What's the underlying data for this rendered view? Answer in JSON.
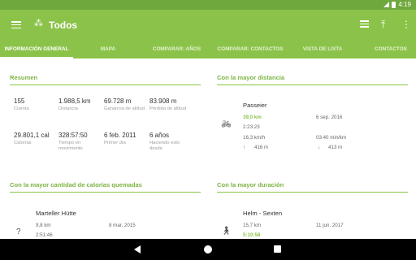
{
  "status": {
    "time": "4:19"
  },
  "appbar": {
    "title": "Todos",
    "logo_glyph": "⁂"
  },
  "tabs": [
    {
      "label": "INFORMACIÓN GENERAL"
    },
    {
      "label": "MAPA"
    },
    {
      "label": "COMPARAR: AÑOS"
    },
    {
      "label": "COMPARAR: CONTACTOS"
    },
    {
      "label": "VISTA DE LISTA"
    },
    {
      "label": "CONTACTOS"
    }
  ],
  "resumen": {
    "title": "Resumen",
    "stats": [
      {
        "value": "155",
        "label": "Cuenta"
      },
      {
        "value": "1.988,5 km",
        "label": "Distancia"
      },
      {
        "value": "69.728 m",
        "label": "Ganancia de altitud"
      },
      {
        "value": "83.908 m",
        "label": "Pérdida de altitud"
      },
      {
        "value": "29.801,1 cal",
        "label": "Calorías"
      },
      {
        "value": "328:57:50",
        "label": "Tiempo en movimiento"
      },
      {
        "value": "6 feb. 2011",
        "label": "Primer día"
      },
      {
        "value": "6 años",
        "label": "Haciendo esto desde"
      }
    ]
  },
  "mayor_distancia": {
    "title": "Con la mayor distancia",
    "name": "Passeier",
    "distance": "39,0 km",
    "date": "6 sep. 2016",
    "duration": "2:23:23",
    "speed": "16,3 km/h",
    "pace": "03:40 min/km",
    "up": "416 m",
    "down": "413 m"
  },
  "mayor_calorias": {
    "title": "Con la mayor cantidad de calorías quemadas",
    "name": "Marteller Hütte",
    "distance": "9,8 km",
    "date": "8 mar. 2015",
    "duration": "2:51:46"
  },
  "mayor_duracion": {
    "title": "Con la mayor duración",
    "name": "Helm - Sexten",
    "distance": "15,7 km",
    "date": "11 jun. 2017",
    "duration": "5:10:58"
  }
}
